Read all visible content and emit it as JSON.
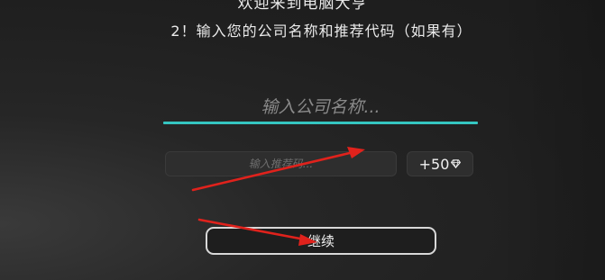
{
  "welcome": {
    "title": "欢迎来到电脑大亨",
    "prompt": "2！输入您的公司名称和推荐代码（如果有）"
  },
  "company": {
    "placeholder": "输入公司名称..."
  },
  "referral": {
    "placeholder": "输入推荐码...",
    "bonus_label": "+50",
    "bonus_icon": "diamond-icon"
  },
  "actions": {
    "continue_label": "继续"
  },
  "colors": {
    "accent_underline": "#35c6c1",
    "annotation_arrow": "#e0221c"
  }
}
